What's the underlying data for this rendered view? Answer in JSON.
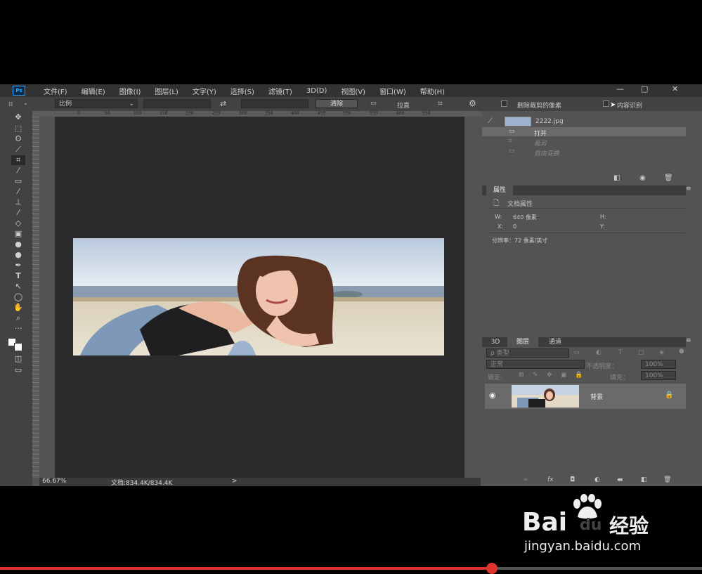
{
  "app": {
    "logo_text": "Ps",
    "menu": [
      "文件(F)",
      "编辑(E)",
      "图像(I)",
      "图层(L)",
      "文字(Y)",
      "选择(S)",
      "滤镜(T)",
      "3D(D)",
      "视图(V)",
      "窗口(W)",
      "帮助(H)"
    ],
    "window_controls": {
      "minimize": "—",
      "maximize": "□",
      "close": "✕"
    }
  },
  "options_bar": {
    "ratio_select": "比例",
    "clear_button": "清除",
    "straighten_label": "拉直",
    "delete_cropped_label": "删除裁剪的像素",
    "content_aware_label": "内容识别"
  },
  "ruler": {
    "ticks": [
      "0",
      "50",
      "100",
      "150",
      "200",
      "250",
      "300",
      "350",
      "400",
      "450",
      "500",
      "550",
      "600",
      "650"
    ]
  },
  "status_bar": {
    "zoom": "66.67%",
    "doc_info": "文档:834.4K/834.4K",
    "arrow": ">"
  },
  "history_panel": {
    "snapshot_name": "2222.jpg",
    "items": [
      "打开",
      "裁剪",
      "自由变换"
    ]
  },
  "properties_panel": {
    "tab": "属性",
    "title": "文档属性",
    "w_label": "W:",
    "w_value": "640 像素",
    "h_label": "H:",
    "x_label": "X:",
    "x_value": "0",
    "y_label": "Y:",
    "resolution": "分辨率：72 像素/英寸"
  },
  "layers_panel": {
    "tabs": [
      "3D",
      "图层",
      "通道"
    ],
    "filter_placeholder": "ρ 类型",
    "blend_mode": "正常",
    "opacity_label": "不透明度：",
    "opacity_value": "100%",
    "lock_label": "锁定:",
    "fill_label": "填充：",
    "fill_value": "100%",
    "layer_name": "背景"
  },
  "watermark": {
    "brand": "Bai",
    "brand2": "du",
    "cn": "经验",
    "url": "jingyan.baidu.com"
  },
  "colors": {
    "ps_bg": "#535353",
    "canvas_bg": "#2b2a2c",
    "progress": "#e0332e"
  }
}
